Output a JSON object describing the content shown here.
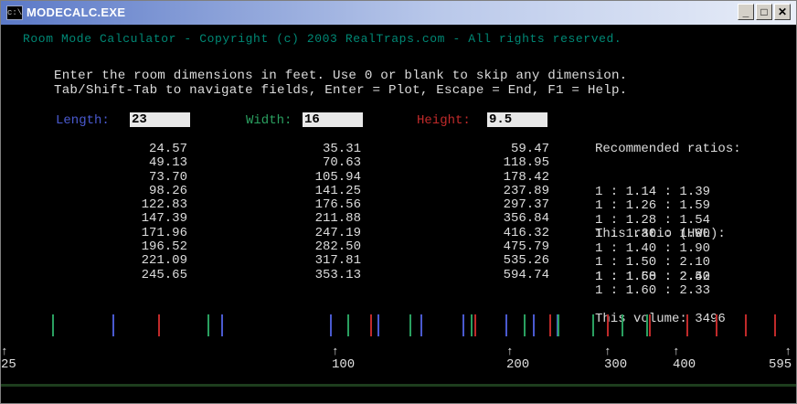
{
  "window": {
    "title": "MODECALC.EXE",
    "icon": "console-icon",
    "min": "_",
    "max": "□",
    "close": "✕"
  },
  "copyright": "Room Mode Calculator - Copyright (c) 2003 RealTraps.com - All rights reserved.",
  "instructions": [
    "Enter the room dimensions in feet. Use 0 or blank to skip any dimension.",
    "Tab/Shift-Tab to navigate fields, Enter = Plot, Escape = End, F1 = Help."
  ],
  "fields": {
    "length": {
      "label": "Length:",
      "value": "23",
      "color": "#4a5ad0"
    },
    "width": {
      "label": "Width:",
      "value": "16",
      "color": "#2aa060"
    },
    "height": {
      "label": "Height:",
      "value": "9.5",
      "color": "#c02a2a"
    }
  },
  "modes": {
    "length": [
      "24.57",
      "49.13",
      "73.70",
      "98.26",
      "122.83",
      "147.39",
      "171.96",
      "196.52",
      "221.09",
      "245.65"
    ],
    "width": [
      "35.31",
      "70.63",
      "105.94",
      "141.25",
      "176.56",
      "211.88",
      "247.19",
      "282.50",
      "317.81",
      "353.13"
    ],
    "height": [
      "59.47",
      "118.95",
      "178.42",
      "237.89",
      "297.37",
      "356.84",
      "416.32",
      "475.79",
      "535.26",
      "594.74"
    ]
  },
  "ratios": {
    "heading": "Recommended ratios:",
    "list": [
      "1 : 1.14 : 1.39",
      "1 : 1.26 : 1.59",
      "1 : 1.28 : 1.54",
      "1 : 1.30 : 1.90",
      "1 : 1.40 : 1.90",
      "1 : 1.50 : 2.10",
      "1 : 1.50 : 2.50",
      "1 : 1.60 : 2.33"
    ],
    "this_ratio_label": "This ratio (HWL):",
    "this_ratio": "1 : 1.68 : 2.42",
    "volume": "This volume: 3496"
  },
  "axis": {
    "ticks": [
      {
        "label": "25",
        "arrow": "↑"
      },
      {
        "label": "100",
        "arrow": "↑"
      },
      {
        "label": "200",
        "arrow": "↑"
      },
      {
        "label": "300",
        "arrow": "↑"
      },
      {
        "label": "400",
        "arrow": "↑"
      },
      {
        "label": "595",
        "arrow": "↑"
      }
    ]
  },
  "colors": {
    "length": "#4a5ad0",
    "width": "#2aa060",
    "height": "#c02a2a",
    "console_bg": "#000000",
    "text": "#dcdcdc"
  }
}
